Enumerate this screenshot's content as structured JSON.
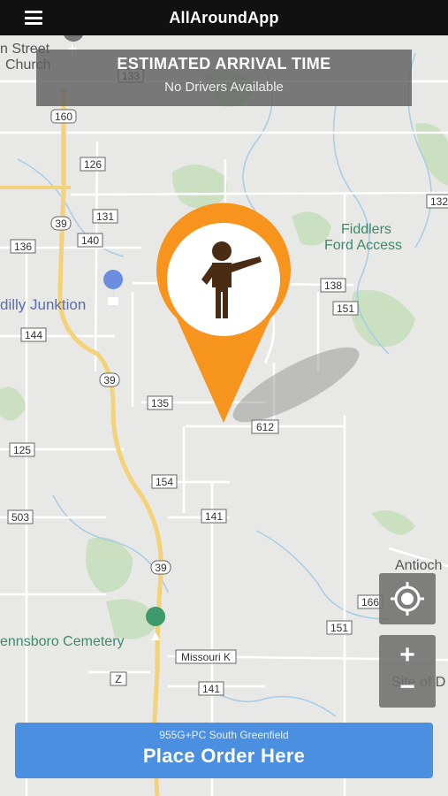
{
  "header": {
    "title": "AllAroundApp",
    "menu_icon": "hamburger-menu-icon"
  },
  "eta": {
    "title": "ESTIMATED ARRIVAL TIME",
    "status": "No Drivers Available"
  },
  "map": {
    "places": {
      "church": [
        "n Street",
        "Church"
      ],
      "fiddlers": [
        "Fiddlers",
        "Ford Access"
      ],
      "junktion": "dilly Junktion",
      "cemetery": "ennsboro Cemetery",
      "antioch": "Antioch",
      "site": "Site of D"
    },
    "roads": {
      "r133": "133",
      "r160": "160",
      "r126": "126",
      "r131": "131",
      "r140": "140",
      "r39a": "39",
      "r136": "136",
      "r138": "138",
      "r151a": "151",
      "r144": "144",
      "r39b": "39",
      "r135": "135",
      "r612": "612",
      "r125": "125",
      "r154": "154",
      "r503": "503",
      "r141a": "141",
      "r39c": "39",
      "r166": "166",
      "r151b": "151",
      "missouri": "Missouri K",
      "rZ": "Z",
      "r141b": "141",
      "r132": "132"
    },
    "marker_icon": "pickup-person-pin-icon",
    "colors": {
      "pin": "#f7941d",
      "road_primary": "#f3d27a",
      "map_bg": "#e8e8e6",
      "water": "#9fc9e6",
      "park": "#bfdcb5"
    }
  },
  "controls": {
    "locate_icon": "crosshair-locate-icon",
    "zoom_in": "+",
    "zoom_out": "−"
  },
  "order": {
    "address": "955G+PC South Greenfield",
    "button_label": "Place Order Here"
  }
}
